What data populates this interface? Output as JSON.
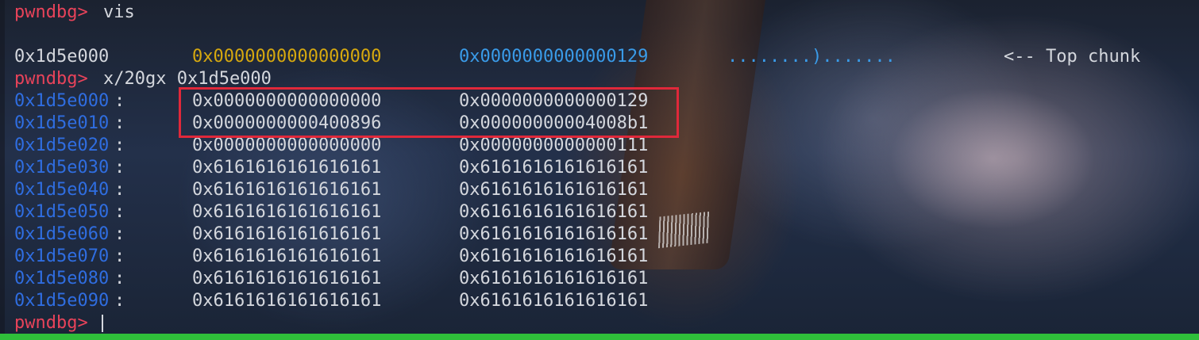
{
  "terminal": {
    "prompt": "pwndbg>",
    "commands": {
      "vis": "vis",
      "examine": "x/20gx 0x1d5e000"
    },
    "vis_output": {
      "address": "0x1d5e000",
      "qword1": "0x0000000000000000",
      "qword2": "0x0000000000000129",
      "ascii": "........).......",
      "annotation": "<-- Top chunk"
    },
    "memory_rows": [
      {
        "address": "0x1d5e000",
        "sep": ":",
        "q1": "0x0000000000000000",
        "q2": "0x0000000000000129"
      },
      {
        "address": "0x1d5e010",
        "sep": ":",
        "q1": "0x0000000000400896",
        "q2": "0x00000000004008b1"
      },
      {
        "address": "0x1d5e020",
        "sep": ":",
        "q1": "0x0000000000000000",
        "q2": "0x0000000000000111"
      },
      {
        "address": "0x1d5e030",
        "sep": ":",
        "q1": "0x6161616161616161",
        "q2": "0x6161616161616161"
      },
      {
        "address": "0x1d5e040",
        "sep": ":",
        "q1": "0x6161616161616161",
        "q2": "0x6161616161616161"
      },
      {
        "address": "0x1d5e050",
        "sep": ":",
        "q1": "0x6161616161616161",
        "q2": "0x6161616161616161"
      },
      {
        "address": "0x1d5e060",
        "sep": ":",
        "q1": "0x6161616161616161",
        "q2": "0x6161616161616161"
      },
      {
        "address": "0x1d5e070",
        "sep": ":",
        "q1": "0x6161616161616161",
        "q2": "0x6161616161616161"
      },
      {
        "address": "0x1d5e080",
        "sep": ":",
        "q1": "0x6161616161616161",
        "q2": "0x6161616161616161"
      },
      {
        "address": "0x1d5e090",
        "sep": ":",
        "q1": "0x6161616161616161",
        "q2": "0x6161616161616161"
      }
    ],
    "colors": {
      "prompt": "#e8435a",
      "address": "#2f6de0",
      "value_yellow": "#d6a80f",
      "value_blue": "#3a9be8",
      "highlight_border": "#e0283a",
      "statusbar": "#2fbf3a"
    }
  }
}
